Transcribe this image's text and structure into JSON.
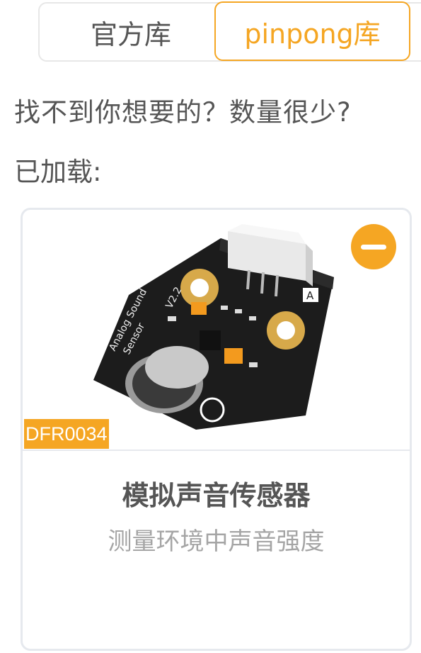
{
  "tabs": {
    "official": "官方库",
    "pinpong": "pinpong库",
    "active": "pinpong"
  },
  "prompt": "找不到你想要的？数量很少?",
  "loaded_label": "已加载:",
  "card": {
    "sku": "DFR0034",
    "title": "模拟声音传感器",
    "description": "测量环境中声音强度",
    "board_text": {
      "line1": "Analog Sound",
      "line2": "Sensor",
      "version": "V2.2",
      "pin_label": "A"
    }
  },
  "colors": {
    "accent": "#f5a623",
    "text": "#555555",
    "muted": "#a5a5a5",
    "board": "#1c1c1c"
  },
  "icons": {
    "remove": "minus-circle-icon",
    "product": "sound-sensor-image"
  }
}
